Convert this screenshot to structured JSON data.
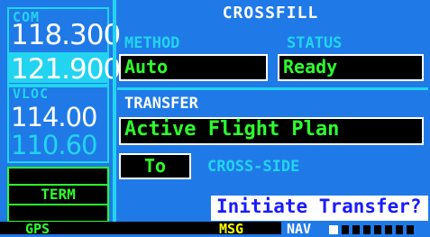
{
  "com": {
    "label": "COM",
    "active": "118.300",
    "standby": "121.900"
  },
  "vloc": {
    "label": "VLOC",
    "active": "114.00",
    "standby": "110.60"
  },
  "annunciator": {
    "term": "TERM"
  },
  "page": {
    "title": "CROSSFILL",
    "method_label": "METHOD",
    "method_value": "Auto",
    "status_label": "STATUS",
    "status_value": "Ready",
    "transfer_label": "TRANSFER",
    "transfer_value": "Active Flight Plan",
    "direction_value": "To",
    "direction_target": "CROSS-SIDE",
    "initiate_button": "Initiate Transfer?"
  },
  "status_bar": {
    "gps": "GPS",
    "msg": "MSG",
    "nav": "NAV"
  },
  "colors": {
    "background": "#1f7ae8",
    "cyan": "#22d4f0",
    "green": "#2cff2c",
    "highlight_text": "#1a1aff"
  }
}
